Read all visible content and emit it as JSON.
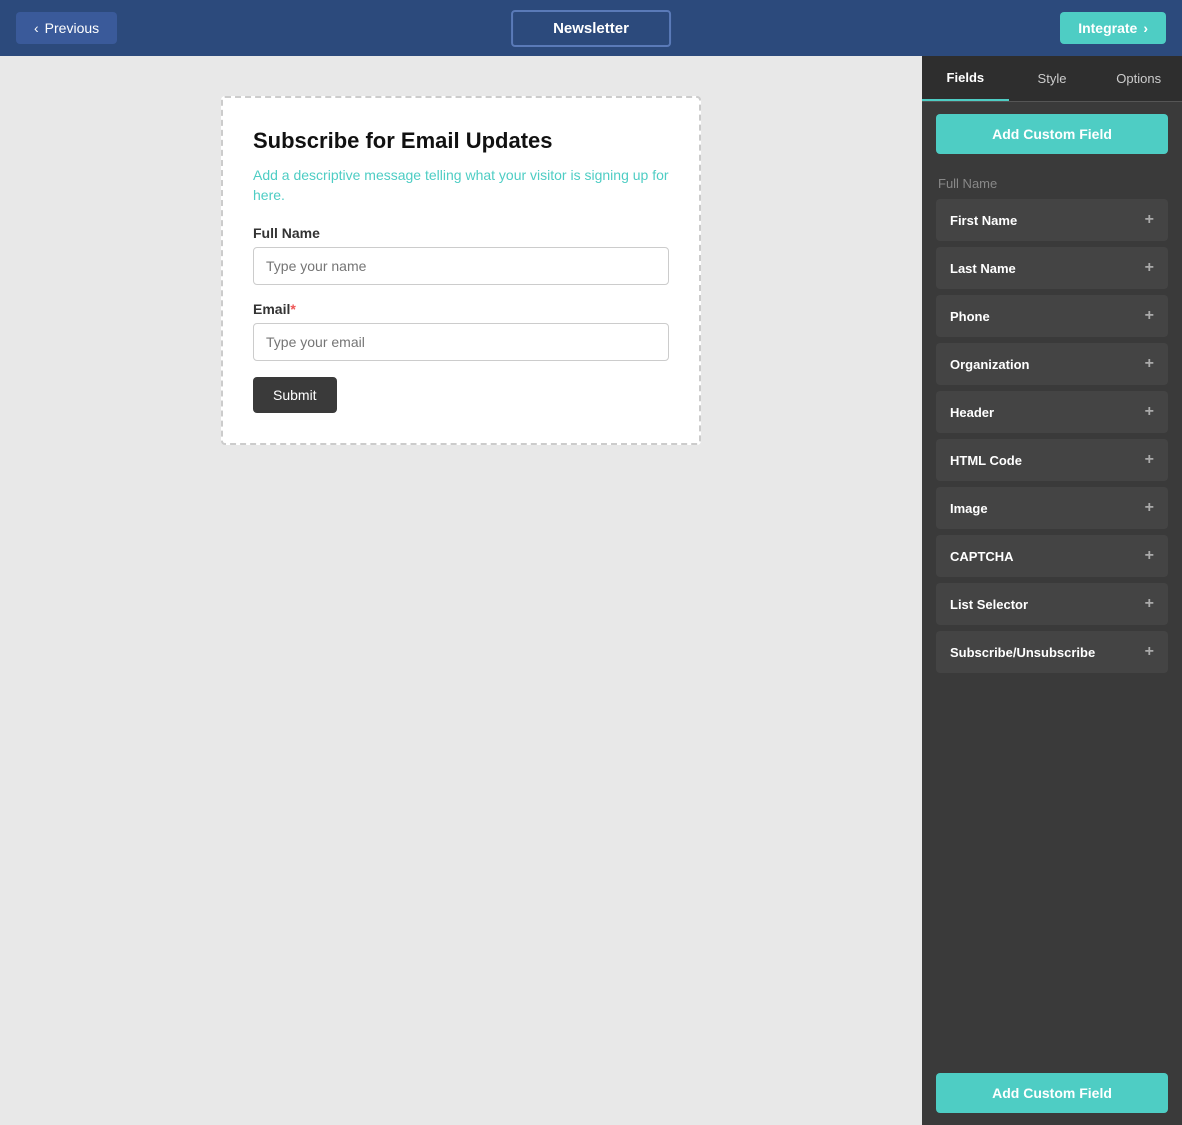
{
  "topbar": {
    "prev_label": "Previous",
    "newsletter_label": "Newsletter",
    "integrate_label": "Integrate",
    "chevron_left": "‹",
    "chevron_right": "›"
  },
  "form": {
    "title": "Subscribe for Email Updates",
    "description_part1": "Add a descriptive message tel",
    "description_highlight": "ling",
    "description_part2": " what your visitor is signing up for here.",
    "full_name_label": "Full Name",
    "full_name_placeholder": "Type your name",
    "email_label": "Email",
    "email_required": "*",
    "email_placeholder": "Type your email",
    "submit_label": "Submit"
  },
  "sidebar": {
    "tabs": [
      {
        "label": "Fields",
        "active": true
      },
      {
        "label": "Style",
        "active": false
      },
      {
        "label": "Options",
        "active": false
      }
    ],
    "add_custom_label": "Add Custom Field",
    "full_name_section": "Full Name",
    "field_items": [
      {
        "label": "First Name"
      },
      {
        "label": "Last Name"
      },
      {
        "label": "Phone"
      },
      {
        "label": "Organization"
      },
      {
        "label": "Header"
      },
      {
        "label": "HTML Code"
      },
      {
        "label": "Image"
      },
      {
        "label": "CAPTCHA"
      },
      {
        "label": "List Selector"
      },
      {
        "label": "Subscribe/Unsubscribe"
      }
    ],
    "plus_icon": "+"
  }
}
